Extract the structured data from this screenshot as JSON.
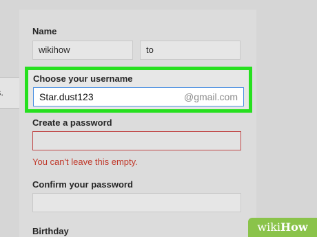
{
  "side_tab": {
    "text": "s."
  },
  "name": {
    "label": "Name",
    "first": "wikihow",
    "last": "to"
  },
  "username": {
    "label": "Choose your username",
    "value": "Star.dust123",
    "suffix": "@gmail.com"
  },
  "password": {
    "label": "Create a password",
    "value": "",
    "error": "You can't leave this empty."
  },
  "confirm": {
    "label": "Confirm your password",
    "value": ""
  },
  "birthday": {
    "label": "Birthday"
  },
  "watermark": {
    "prefix": "wiki",
    "suffix": "How"
  },
  "colors": {
    "highlight": "#26e01f",
    "error": "#c0392b",
    "watermark": "#8ac34a"
  }
}
